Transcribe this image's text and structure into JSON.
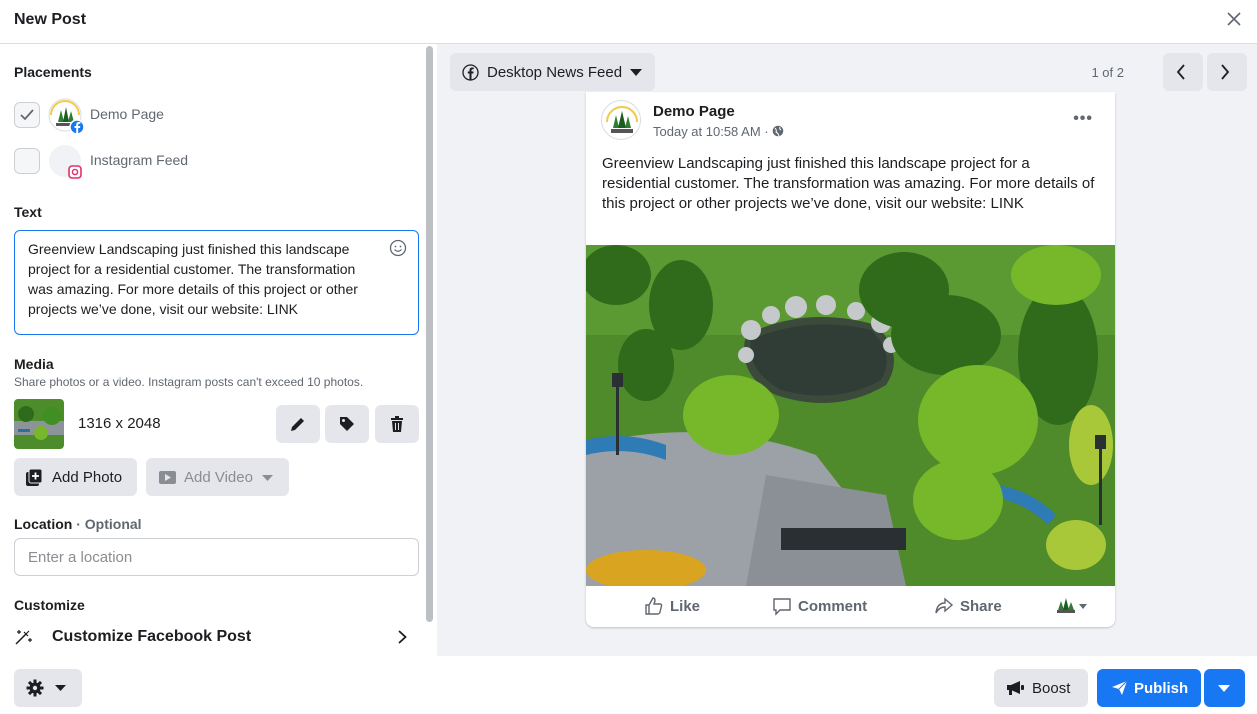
{
  "header": {
    "title": "New Post",
    "close_icon": "close-icon"
  },
  "placements": {
    "title": "Placements",
    "items": [
      {
        "label": "Demo Page",
        "checked": true,
        "badge_icon": "facebook-badge-icon"
      },
      {
        "label": "Instagram Feed",
        "checked": false,
        "badge_icon": "instagram-badge-icon"
      }
    ]
  },
  "text": {
    "title": "Text",
    "value": "Greenview Landscaping just finished this landscape project for a residential customer. The transformation was amazing. For more details of this project or other projects we’ve done, visit our website: LINK"
  },
  "media": {
    "title": "Media",
    "subtitle": "Share photos or a video. Instagram posts can't exceed 10 photos.",
    "item_dimensions": "1316 x 2048",
    "add_photo_label": "Add Photo",
    "add_video_label": "Add Video"
  },
  "location": {
    "title": "Location",
    "optional": "· Optional",
    "placeholder": "Enter a location"
  },
  "customize": {
    "title": "Customize",
    "row_label": "Customize Facebook Post"
  },
  "preview": {
    "feed_select": "Desktop News Feed",
    "pager": "1 of 2",
    "post": {
      "page_name": "Demo Page",
      "time": "Today at 10:58 AM ·",
      "text": "Greenview Landscaping just finished this landscape project for a residential customer. The transformation was amazing. For more details of this project or other projects we’ve done, visit our website: LINK",
      "actions": {
        "like": "Like",
        "comment": "Comment",
        "share": "Share"
      }
    }
  },
  "footer": {
    "boost_label": "Boost",
    "publish_label": "Publish"
  },
  "colors": {
    "accent": "#1877f2",
    "button_gray": "#e4e6eb",
    "preview_bg": "#f0f2f5"
  }
}
